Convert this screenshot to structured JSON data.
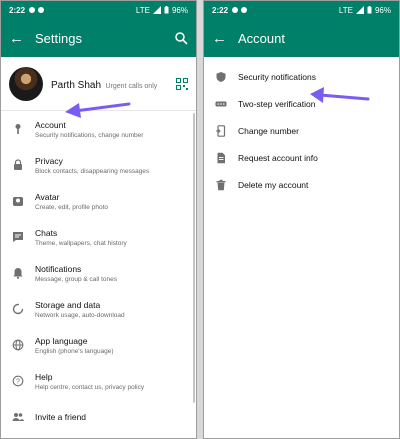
{
  "left": {
    "status": {
      "time": "2:22",
      "network": "LTE",
      "battery": "96%"
    },
    "appbar": {
      "title": "Settings"
    },
    "profile": {
      "name": "Parth Shah",
      "status": "Urgent calls only"
    },
    "items": [
      {
        "label": "Account",
        "sub": "Security notifications, change number",
        "icon": "key-icon"
      },
      {
        "label": "Privacy",
        "sub": "Block contacts, disappearing messages",
        "icon": "lock-icon"
      },
      {
        "label": "Avatar",
        "sub": "Create, edit, profile photo",
        "icon": "avatar-icon"
      },
      {
        "label": "Chats",
        "sub": "Theme, wallpapers, chat history",
        "icon": "chat-icon"
      },
      {
        "label": "Notifications",
        "sub": "Message, group & call tones",
        "icon": "bell-icon"
      },
      {
        "label": "Storage and data",
        "sub": "Network usage, auto-download",
        "icon": "storage-icon"
      },
      {
        "label": "App language",
        "sub": "English (phone's language)",
        "icon": "globe-icon"
      },
      {
        "label": "Help",
        "sub": "Help centre, contact us, privacy policy",
        "icon": "help-icon"
      },
      {
        "label": "Invite a friend",
        "sub": "",
        "icon": "people-icon"
      }
    ]
  },
  "right": {
    "status": {
      "time": "2:22",
      "network": "LTE",
      "battery": "96%"
    },
    "appbar": {
      "title": "Account"
    },
    "items": [
      {
        "label": "Security notifications",
        "icon": "shield-icon"
      },
      {
        "label": "Two-step verification",
        "icon": "dots-icon"
      },
      {
        "label": "Change number",
        "icon": "phone-icon"
      },
      {
        "label": "Request account info",
        "icon": "document-icon"
      },
      {
        "label": "Delete my account",
        "icon": "trash-icon"
      }
    ]
  },
  "colors": {
    "header": "#008069",
    "arrow": "#7b5cf0",
    "icon": "#707070"
  }
}
